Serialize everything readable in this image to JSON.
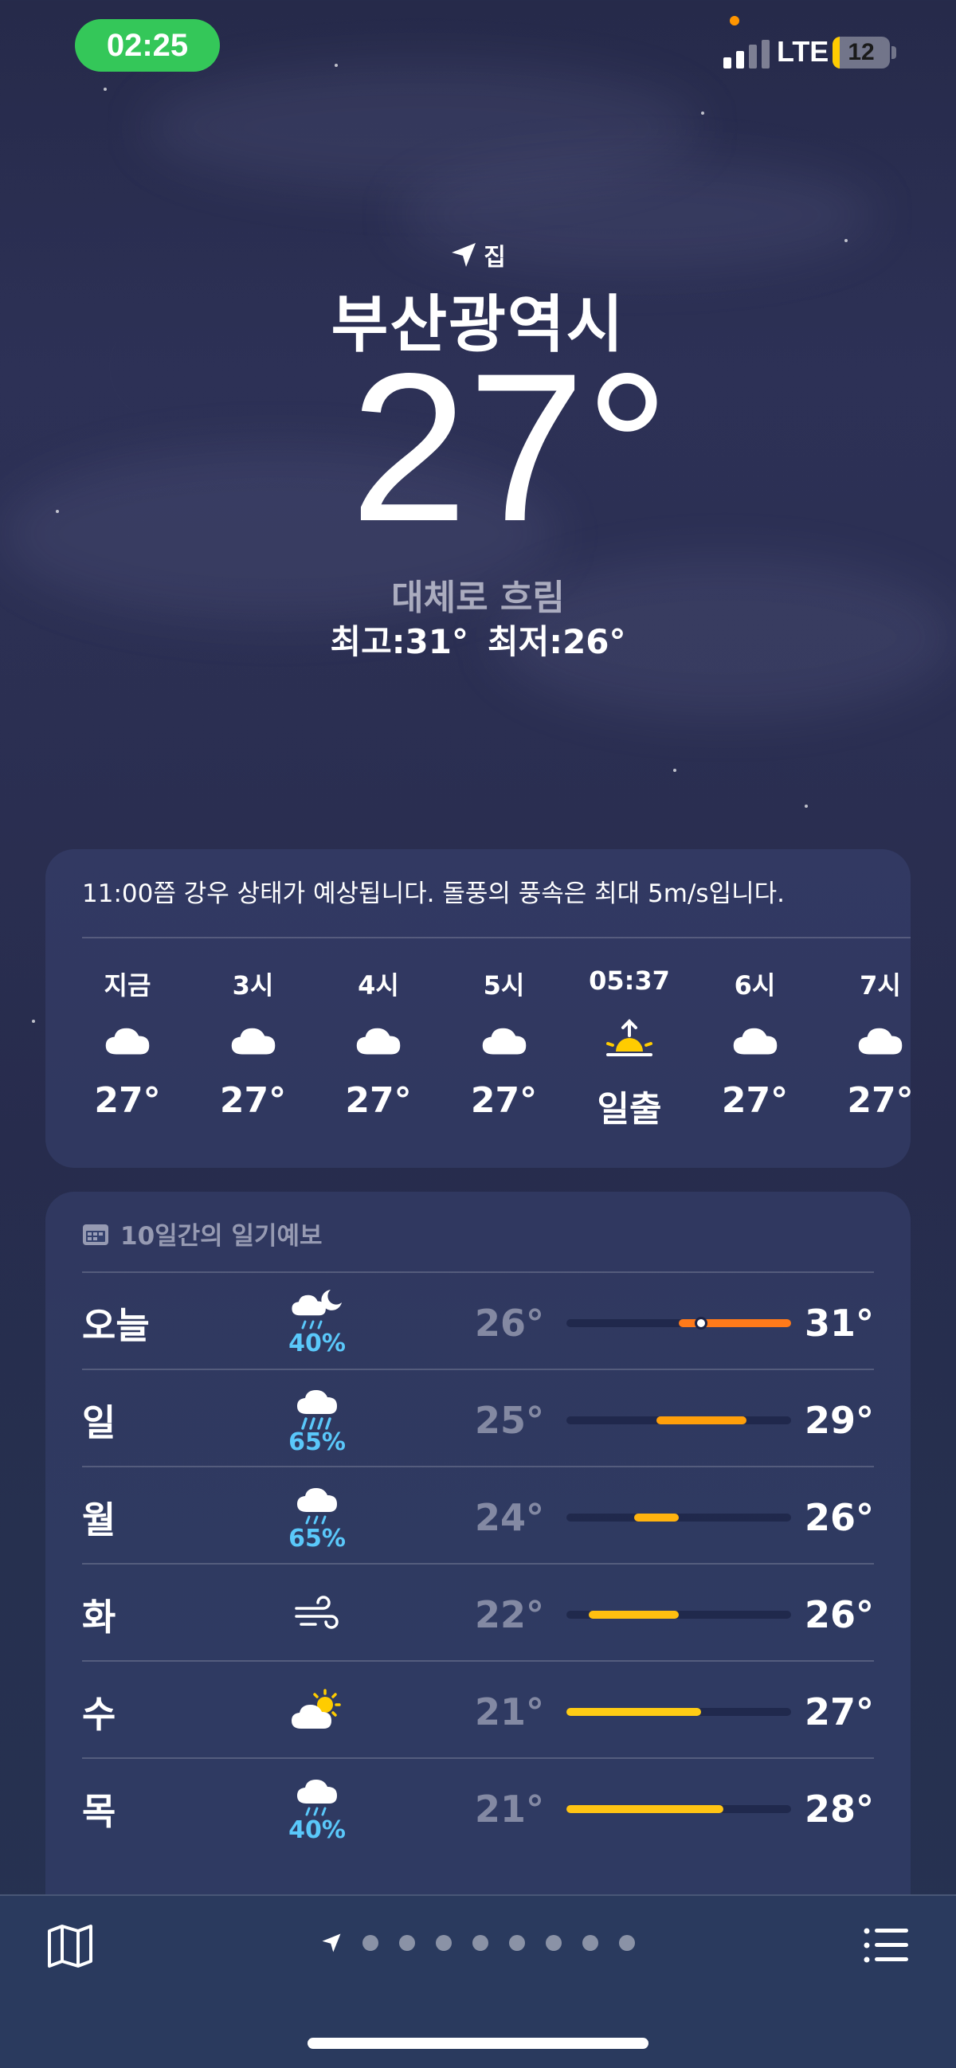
{
  "status_bar": {
    "time": "02:25",
    "network": "LTE",
    "battery": "12",
    "battery_level": 0.12
  },
  "header": {
    "location_label": "집",
    "city": "부산광역시",
    "temperature": "27°",
    "condition": "대체로 흐림",
    "high": "최고:31°",
    "low": "최저:26°"
  },
  "hourly": {
    "summary": "11:00쯤 강우 상태가 예상됩니다. 돌풍의 풍속은 최대 5m/s입니다.",
    "items": [
      {
        "label": "지금",
        "icon": "cloud-icon",
        "value": "27°"
      },
      {
        "label": "3시",
        "icon": "cloud-icon",
        "value": "27°"
      },
      {
        "label": "4시",
        "icon": "cloud-icon",
        "value": "27°"
      },
      {
        "label": "5시",
        "icon": "cloud-icon",
        "value": "27°"
      },
      {
        "label": "05:37",
        "icon": "sunrise-icon",
        "value": "일출"
      },
      {
        "label": "6시",
        "icon": "cloud-icon",
        "value": "27°"
      },
      {
        "label": "7시",
        "icon": "cloud-icon",
        "value": "27°"
      }
    ]
  },
  "daily": {
    "title": "10일간의 일기예보",
    "range_min": 21,
    "range_max": 31,
    "days": [
      {
        "day": "오늘",
        "icon": "cloud-moon-rain-icon",
        "precip": "40%",
        "low": "26°",
        "high": "31°",
        "low_v": 26,
        "high_v": 31,
        "current_v": 27,
        "color": "#ff7a1a"
      },
      {
        "day": "일",
        "icon": "cloud-rain-icon",
        "precip": "65%",
        "low": "25°",
        "high": "29°",
        "low_v": 25,
        "high_v": 29,
        "color": "#ff9f0a"
      },
      {
        "day": "월",
        "icon": "cloud-drizzle-icon",
        "precip": "65%",
        "low": "24°",
        "high": "26°",
        "low_v": 24,
        "high_v": 26,
        "color": "#ffb30f"
      },
      {
        "day": "화",
        "icon": "wind-icon",
        "precip": "",
        "low": "22°",
        "high": "26°",
        "low_v": 22,
        "high_v": 26,
        "color": "#ffbf10"
      },
      {
        "day": "수",
        "icon": "partly-sunny-icon",
        "precip": "",
        "low": "21°",
        "high": "27°",
        "low_v": 21,
        "high_v": 27,
        "color": "#ffcc14"
      },
      {
        "day": "목",
        "icon": "cloud-drizzle-icon",
        "precip": "40%",
        "low": "21°",
        "high": "28°",
        "low_v": 21,
        "high_v": 28,
        "color": "#ffc414"
      }
    ]
  },
  "bottom_bar": {
    "page_count": 8
  },
  "colors": {
    "precip": "#5ac8fa",
    "status_green": "#34c759",
    "battery_yellow": "#ffcc00"
  }
}
